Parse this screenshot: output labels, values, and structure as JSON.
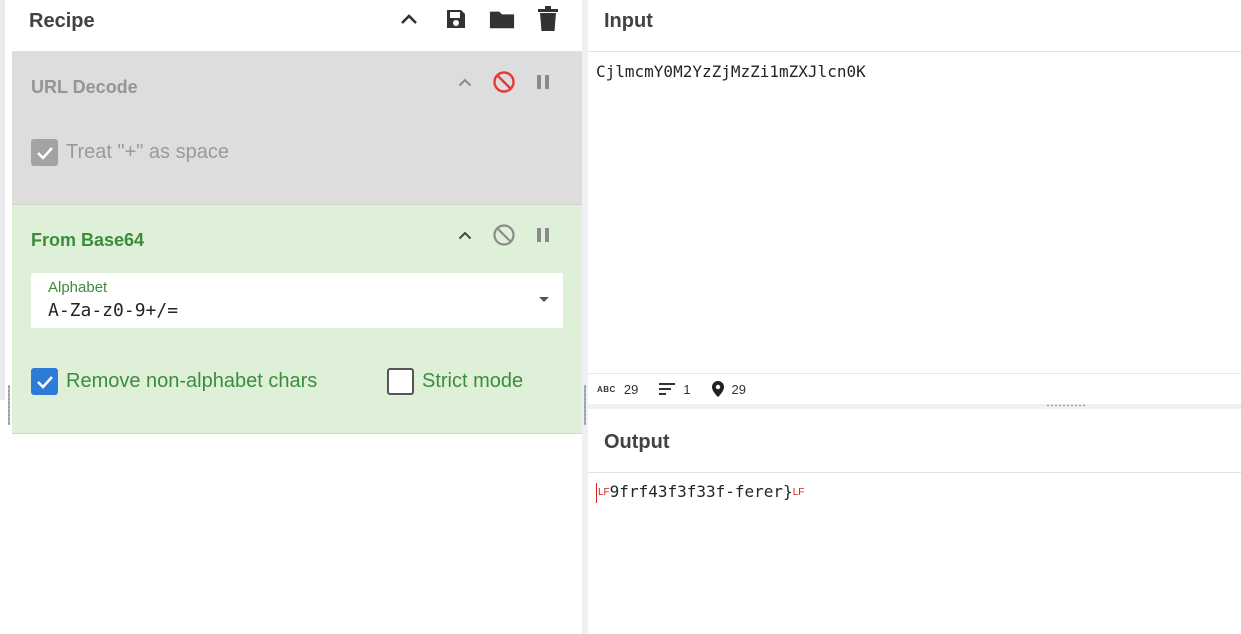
{
  "recipe": {
    "title": "Recipe",
    "icons": [
      "chevron-up-icon",
      "save-icon",
      "folder-icon",
      "trash-icon"
    ],
    "operations": [
      {
        "name": "URL Decode",
        "state": "disabled",
        "controls": [
          "chevron-up-icon",
          "disable-icon",
          "pause-icon"
        ],
        "options": [
          {
            "label": "Treat \"+\" as space",
            "checked": true
          }
        ]
      },
      {
        "name": "From Base64",
        "state": "active",
        "controls": [
          "chevron-up-icon",
          "disable-icon",
          "pause-icon"
        ],
        "alphabet": {
          "label": "Alphabet",
          "value": "A-Za-z0-9+/="
        },
        "options": [
          {
            "label": "Remove non-alphabet chars",
            "checked": true
          },
          {
            "label": "Strict mode",
            "checked": false
          }
        ]
      }
    ]
  },
  "input": {
    "title": "Input",
    "text": "CjlmcmY0M2YzZjMzZi1mZXJlcn0K",
    "status": {
      "length": "29",
      "lines": "1",
      "position": "29"
    }
  },
  "output": {
    "title": "Output",
    "lf_marker": "LF",
    "text": "9frf43f3f33f-ferer}"
  },
  "colors": {
    "active_op_bg": "#dff0d8",
    "active_op_text": "#3c8c3c",
    "disabled_op_bg": "#dddddd",
    "checkbox_blue": "#2c7bd6",
    "disable_red": "#e53935"
  }
}
